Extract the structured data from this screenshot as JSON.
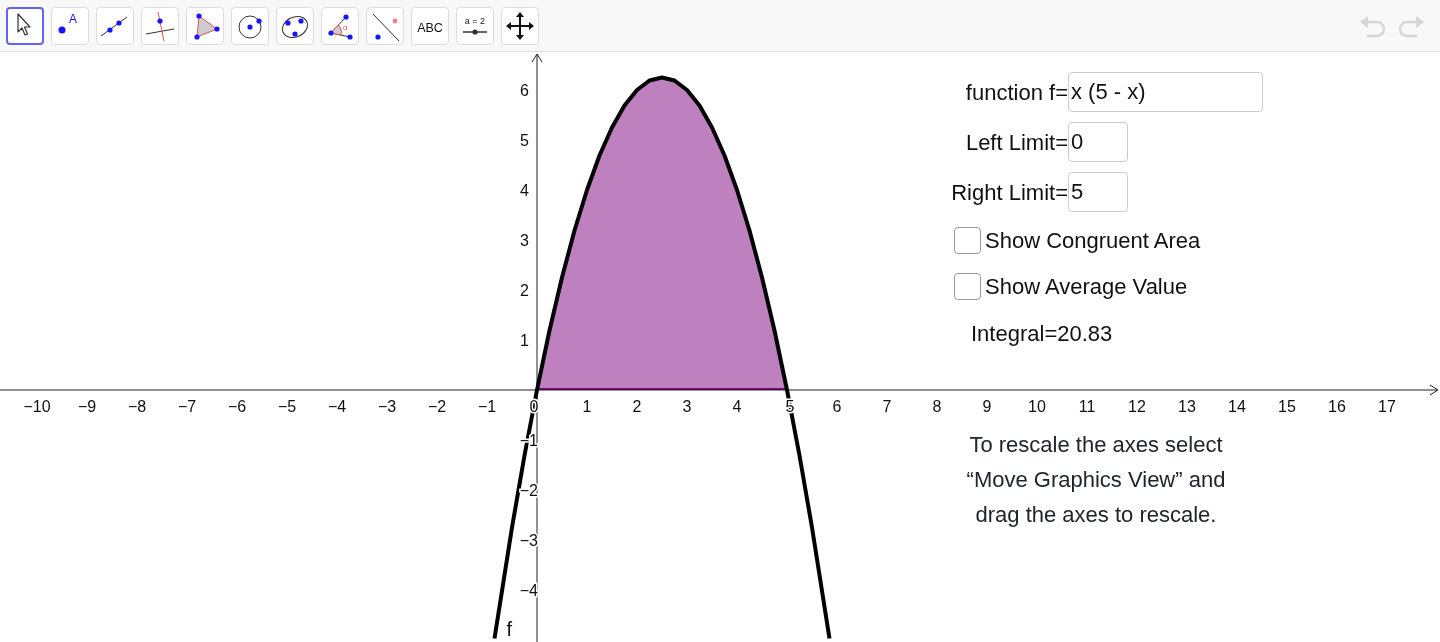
{
  "toolbar": {
    "tools": [
      {
        "kind": "move",
        "selected": true
      },
      {
        "kind": "point",
        "selected": false,
        "label": "A"
      },
      {
        "kind": "line",
        "selected": false
      },
      {
        "kind": "perpendicular",
        "selected": false
      },
      {
        "kind": "polygon",
        "selected": false
      },
      {
        "kind": "circle",
        "selected": false
      },
      {
        "kind": "conic",
        "selected": false
      },
      {
        "kind": "angle",
        "selected": false,
        "label": "α"
      },
      {
        "kind": "reflect",
        "selected": false
      },
      {
        "kind": "text",
        "selected": false,
        "label": "ABC"
      },
      {
        "kind": "slider",
        "selected": false,
        "label": "a = 2"
      },
      {
        "kind": "move_view",
        "selected": false
      }
    ],
    "history": [
      {
        "kind": "undo",
        "disabled": true
      },
      {
        "kind": "redo",
        "disabled": true
      }
    ]
  },
  "graph": {
    "chart_data": {
      "type": "line",
      "x": [
        -0.85,
        -0.5,
        -0.25,
        0,
        0.25,
        0.5,
        0.75,
        1,
        1.25,
        1.5,
        1.75,
        2,
        2.25,
        2.5,
        2.75,
        3,
        3.25,
        3.5,
        3.75,
        4,
        4.25,
        4.5,
        4.75,
        5,
        5.25,
        5.5,
        5.85
      ],
      "series": [
        {
          "name": "f",
          "color": "#000000",
          "values": [
            -4.97,
            -2.75,
            -1.31,
            0,
            1.19,
            2.25,
            3.19,
            4,
            4.69,
            5.25,
            5.69,
            6,
            6.19,
            6.25,
            6.19,
            6,
            5.69,
            5.25,
            4.69,
            4,
            3.19,
            2.25,
            1.19,
            0,
            -1.31,
            -2.75,
            -4.97
          ]
        }
      ],
      "xlim": [
        -10.74,
        18.06
      ],
      "ylim": [
        -5.04,
        6.76
      ],
      "xticks": [
        {
          "value": -10,
          "label": "−10"
        },
        {
          "value": -9,
          "label": "−9"
        },
        {
          "value": -8,
          "label": "−8"
        },
        {
          "value": -7,
          "label": "−7"
        },
        {
          "value": -6,
          "label": "−6"
        },
        {
          "value": -5,
          "label": "−5"
        },
        {
          "value": -4,
          "label": "−4"
        },
        {
          "value": -3,
          "label": "−3"
        },
        {
          "value": -2,
          "label": "−2"
        },
        {
          "value": -1,
          "label": "−1"
        },
        0,
        1,
        2,
        3,
        4,
        5,
        6,
        7,
        8,
        9,
        10,
        11,
        12,
        13,
        14,
        15,
        16,
        17
      ],
      "yticks": [
        {
          "value": -4,
          "label": "−4"
        },
        {
          "value": -3,
          "label": "−3"
        },
        {
          "value": -2,
          "label": "−2"
        },
        {
          "value": -1,
          "label": "−1"
        },
        1,
        2,
        3,
        4,
        5,
        6
      ]
    }
  },
  "panel": {
    "fields": [
      {
        "kind": "expression",
        "label": "function f=",
        "value": "x (5 - x)"
      },
      {
        "kind": "number",
        "label": "Left Limit=",
        "value": "0"
      },
      {
        "kind": "number",
        "label": "Right Limit=",
        "value": "5"
      }
    ],
    "checkboxes": [
      {
        "label": "Show Congruent Area",
        "checked": false
      },
      {
        "label": "Show Average Value",
        "checked": false
      }
    ],
    "result": "Integral=20.83",
    "note": "To rescale the axes select “Move Graphics View” and drag the axes to rescale."
  }
}
